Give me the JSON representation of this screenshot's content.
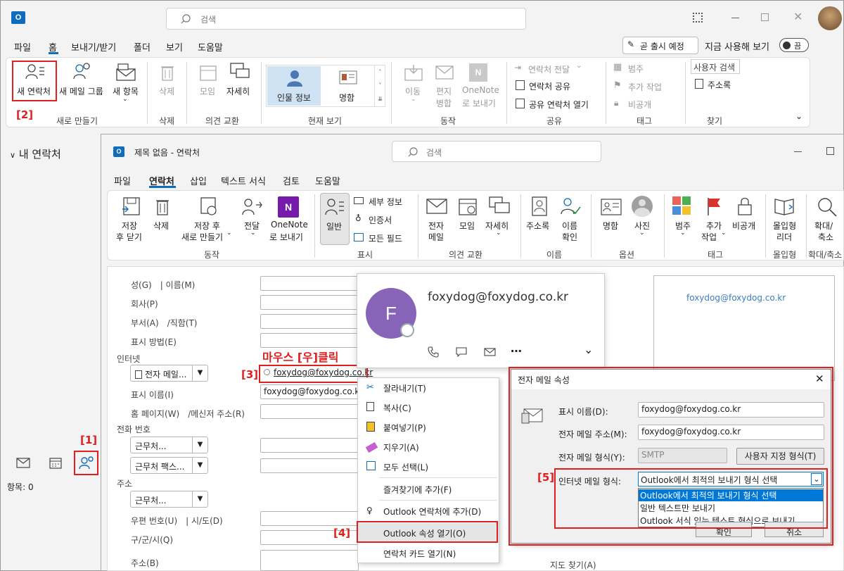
{
  "main_window": {
    "search_placeholder": "검색",
    "menu_tabs": [
      "파일",
      "홈",
      "보내기/받기",
      "폴더",
      "보기",
      "도움말"
    ],
    "coming_soon": "곧 출시 예정",
    "try_now": "지금 사용해 보기",
    "toggle_label": "끔",
    "ribbon": {
      "new_contact": "새 연락처",
      "new_contact_group": "새 메일 그룹",
      "new_items": "새 항목",
      "group_new": "새로 만들기",
      "delete": "삭제",
      "group_delete": "삭제",
      "meeting": "모임",
      "more": "자세히",
      "group_communicate": "의견 교환",
      "view_people": "인물 정보",
      "view_card": "명함",
      "group_current_view": "현재 보기",
      "move": "이동",
      "mail_merge_1": "편지",
      "mail_merge_2": "병합",
      "onenote_1": "OneNote",
      "onenote_2": "로 보내기",
      "group_actions": "동작",
      "forward_contact": "연락처 전달",
      "share_contacts": "연락처 공유",
      "open_shared": "공유 연락처 열기",
      "group_share": "공유",
      "categorize": "범주",
      "follow_up": "추가 작업",
      "private": "비공개",
      "group_tags": "태그",
      "search_people": "사용자 검색",
      "address_book": "주소록",
      "group_find": "찾기"
    },
    "nav_my_contacts": "내 연락처",
    "status_items": "항목: 0"
  },
  "contact_window": {
    "title": "제목 없음 - 연락처",
    "search_placeholder": "검색",
    "menu_tabs": [
      "파일",
      "연락처",
      "삽입",
      "텍스트 서식",
      "검토",
      "도움말"
    ],
    "ribbon": {
      "save_close_1": "저장",
      "save_close_2": "후 닫기",
      "delete": "삭제",
      "save_new_1": "저장 후",
      "save_new_2": "새로 만들기",
      "forward": "전달",
      "onenote_1": "OneNote",
      "onenote_2": "로 보내기",
      "group_actions": "동작",
      "general": "일반",
      "details": "세부 정보",
      "certificates": "인증서",
      "all_fields": "모든 필드",
      "group_show": "표시",
      "email": "전자",
      "email_2": "메일",
      "meeting": "모임",
      "more": "자세히",
      "group_communicate": "의견 교환",
      "address_book": "주소록",
      "check_names_1": "이름",
      "check_names_2": "확인",
      "group_names": "이름",
      "business_card": "명함",
      "picture": "사진",
      "group_options": "옵션",
      "categorize": "범주",
      "follow_up_1": "추가",
      "follow_up_2": "작업",
      "private": "비공개",
      "group_tags": "태그",
      "immersive_1": "몰입형",
      "immersive_2": "리더",
      "group_immersive": "몰입형",
      "zoom_1": "확대/",
      "zoom_2": "축소",
      "group_zoom": "확대/축소"
    },
    "form": {
      "full_name": "성(G)　| 이름(M)",
      "company": "회사(P)",
      "job_title": "부서(A)　/직함(T)",
      "file_as": "표시 방법(E)",
      "internet": "인터넷",
      "email_dropdown": "전자 메일...",
      "email_value": "foxydog@foxydog.co.kr",
      "display_as": "표시 이름(I)",
      "display_as_value": "foxydog@foxydog.co.kr",
      "web_page": "홈 페이지(W)　/메신저 주소(R)",
      "phone_numbers": "전화 번호",
      "phone_business": "근무처...",
      "phone_fax": "근무처 팩스...",
      "addresses": "주소",
      "address_business": "근무처...",
      "zip": "우편 번호(U)　| 시/도(D)",
      "city": "구/군/시(Q)",
      "street": "주소(B)",
      "map_it": "지도 찾기(A)"
    },
    "business_card_email": "foxydog@foxydog.co.kr"
  },
  "contact_card": {
    "initial": "F",
    "email": "foxydog@foxydog.co.kr",
    "avatar_color": "#8764b8"
  },
  "context_menu": {
    "items": [
      "잘라내기(T)",
      "복사(C)",
      "붙여넣기(P)",
      "지우기(A)",
      "모두 선택(L)",
      "즐겨찾기에 추가(F)",
      "Outlook 연락처에 추가(D)",
      "Outlook 속성 열기(O)",
      "연락처 카드 열기(N)"
    ]
  },
  "email_properties": {
    "title": "전자 메일 속성",
    "display_name_label": "표시 이름(D):",
    "display_name_value": "foxydog@foxydog.co.kr",
    "email_address_label": "전자 메일 주소(M):",
    "email_address_value": "foxydog@foxydog.co.kr",
    "email_type_label": "전자 메일 형식(Y):",
    "email_type_value": "SMTP",
    "custom_type_button": "사용자 지정 형식(T)",
    "internet_format_label": "인터넷 메일 형식:",
    "internet_format_value": "Outlook에서 최적의 보내기 형식 선택",
    "options": [
      "Outlook에서 최적의 보내기 형식 선택",
      "일반 텍스트만 보내기",
      "Outlook 서식 있는 텍스트 형식으로 보내기"
    ],
    "ok_partial": "확인",
    "cancel_partial": "취소"
  },
  "annotations": {
    "step1": "[1]",
    "step2": "[2]",
    "step3": "[3]",
    "step4": "[4]",
    "step5": "[5]",
    "right_click": "마우스 [우]클릭"
  },
  "colors": {
    "outlook_blue": "#0f6cbd",
    "annotation_red": "#e02020",
    "selection_blue": "#0078d7",
    "ribbon_selected": "#cfe3f5"
  }
}
